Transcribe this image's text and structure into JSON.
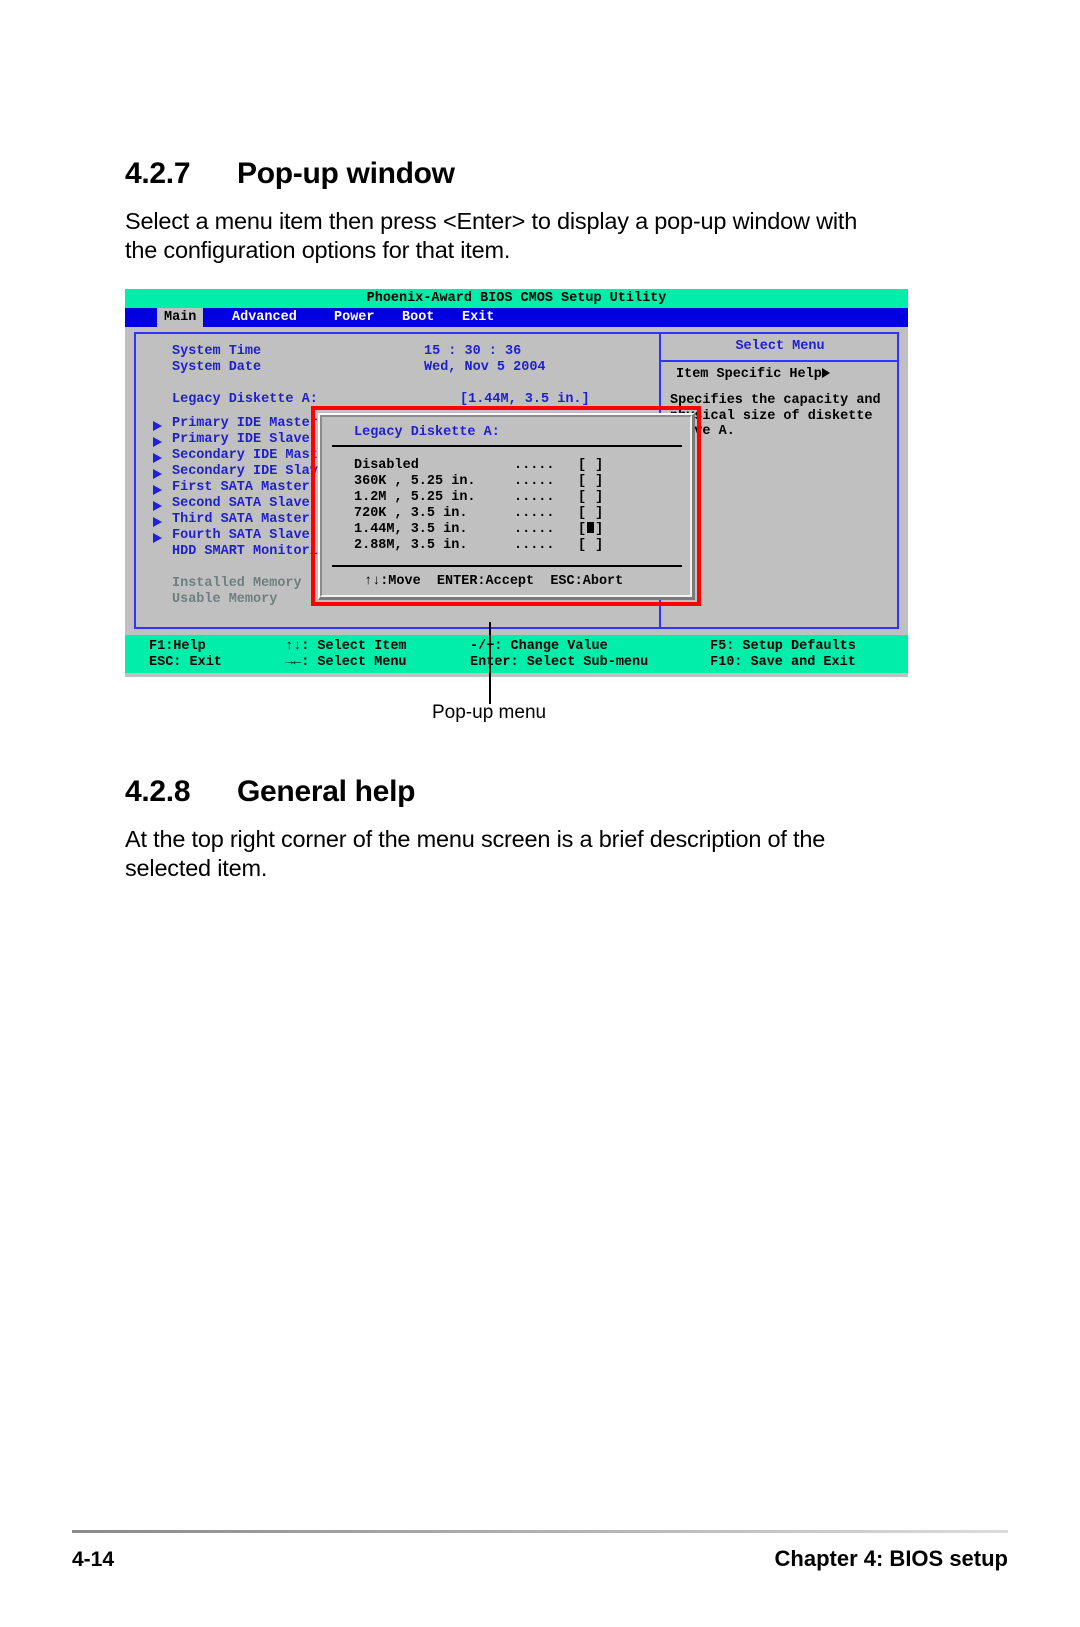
{
  "sections": [
    {
      "number": "4.2.7",
      "title": "Pop-up window",
      "body": "Select a menu item then press <Enter> to display a pop-up window with the configuration options for that item."
    },
    {
      "number": "4.2.8",
      "title": "General help",
      "body": "At the top right corner of the menu screen is a brief description of the selected item."
    }
  ],
  "callout": {
    "label": "Pop-up menu"
  },
  "footer": {
    "page_number": "4-14",
    "chapter": "Chapter 4: BIOS setup"
  },
  "bios": {
    "title": "Phoenix-Award BIOS CMOS Setup Utility",
    "tabs": [
      {
        "label": "Main",
        "active": true
      },
      {
        "label": "Advanced",
        "active": false
      },
      {
        "label": "Power",
        "active": false
      },
      {
        "label": "Boot",
        "active": false
      },
      {
        "label": "Exit",
        "active": false
      }
    ],
    "fields": [
      {
        "label": "System Time",
        "value": "15 : 30 : 36"
      },
      {
        "label": "System Date",
        "value": "Wed, Nov 5 2004"
      },
      {
        "label": "Legacy Diskette A:",
        "value": "[1.44M, 3.5 in.]"
      }
    ],
    "submenus": [
      "Primary IDE Master",
      "Primary IDE Slave",
      "Secondary IDE Master",
      "Secondary IDE Slave",
      "First SATA Master",
      "Second SATA Slave",
      "Third SATA Master",
      "Fourth SATA Slave"
    ],
    "plain_items": [
      "HDD SMART Monitoring"
    ],
    "memory_items": [
      "Installed Memory",
      "Usable Memory"
    ],
    "help": {
      "panel_title": "Select Menu",
      "item_label": "Item Specific Help",
      "lines": [
        "Specifies the capacity and",
        "physical size of diskette",
        "drive A."
      ]
    },
    "keybar": [
      {
        "key": "F1:Help"
      },
      {
        "key": "↑↓: Select Item"
      },
      {
        "key": "-/+: Change Value"
      },
      {
        "key": "F5: Setup Defaults"
      },
      {
        "key": "ESC: Exit"
      },
      {
        "key": "→←: Select Menu"
      },
      {
        "key": "Enter: Select Sub-menu"
      },
      {
        "key": "F10: Save and Exit"
      }
    ],
    "popup": {
      "title": "Legacy Diskette A:",
      "options": [
        {
          "label": "Disabled",
          "dots": ".....",
          "selected": false
        },
        {
          "label": "360K , 5.25 in.",
          "dots": ".....",
          "selected": false
        },
        {
          "label": "1.2M , 5.25 in.",
          "dots": ".....",
          "selected": false
        },
        {
          "label": "720K , 3.5 in.",
          "dots": ".....",
          "selected": false
        },
        {
          "label": "1.44M, 3.5 in.",
          "dots": ".....",
          "selected": true
        },
        {
          "label": "2.88M, 3.5 in.",
          "dots": ".....",
          "selected": false
        }
      ],
      "footer": "↑↓:Move  ENTER:Accept  ESC:Abort"
    }
  },
  "colors": {
    "bios_header": "#00eeaa",
    "bios_menubar": "#0000e0",
    "bios_background": "#c0c0c0",
    "bios_text_blue": "#1f1fd0",
    "highlight_red": "#ff0000"
  }
}
